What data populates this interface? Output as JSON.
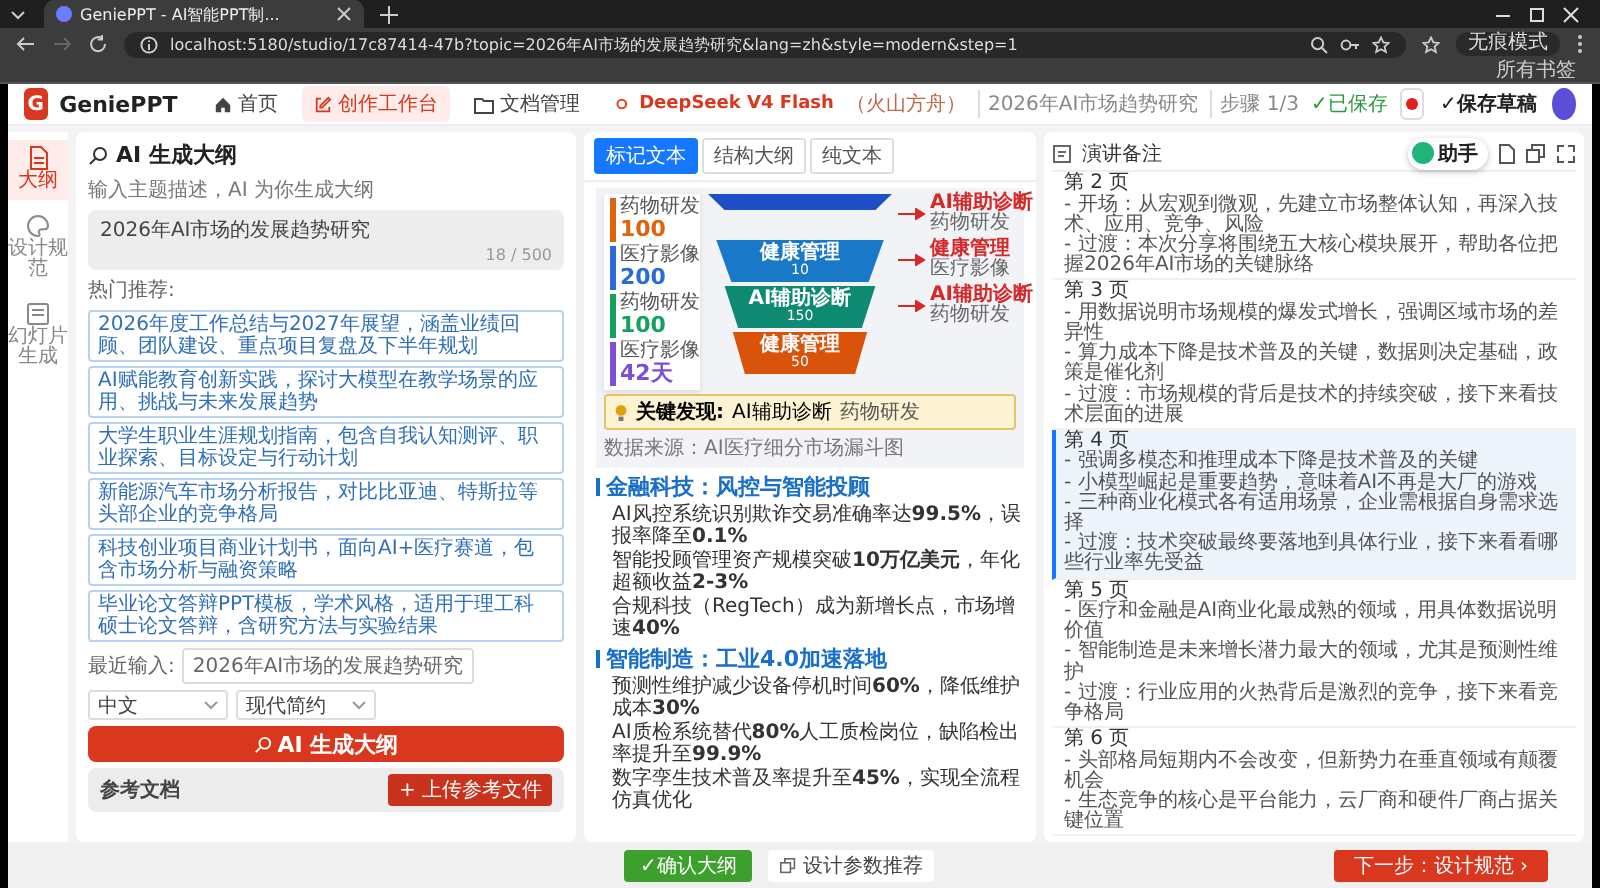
{
  "browser": {
    "tab_title": "GeniePPT - AI智能PPT制...",
    "url": "localhost:5180/studio/17c87414-47b?topic=2026年AI市场的发展趋势研究&lang=zh&style=modern&step=1",
    "profile": "无痕模式",
    "bookmarks": "所有书签"
  },
  "header": {
    "logo": "G",
    "brand": "GeniePPT",
    "nav": [
      {
        "label": "首页",
        "selected": false
      },
      {
        "label": "创作工作台",
        "selected": true
      },
      {
        "label": "文档管理",
        "selected": false
      }
    ],
    "model": "DeepSeek V4 Flash",
    "provider": "（火山方舟）",
    "project": "2026年AI市场趋势研究",
    "step": "步骤 1/3",
    "save_status": "✓已保存",
    "save_button": "✓保存草稿"
  },
  "sidebar": [
    {
      "label": "大纲",
      "selected": true
    },
    {
      "label": "设计规范",
      "selected": false
    },
    {
      "label": "幻灯片生成",
      "selected": false
    }
  ],
  "outline_panel": {
    "title": "AI 生成大纲",
    "subtitle": "输入主题描述，AI 为你生成大纲",
    "topic": "2026年AI市场的发展趋势研究",
    "counter": "18 / 500",
    "hot_label": "热门推荐:",
    "hot_topics": [
      "2026年度工作总结与2027年展望，涵盖业绩回顾、团队建设、重点项目复盘及下半年规划",
      "AI赋能教育创新实践，探讨大模型在教学场景的应用、挑战与未来发展趋势",
      "大学生职业生涯规划指南，包含自我认知测评、职业探索、目标设定与行动计划",
      "新能源汽车市场分析报告，对比比亚迪、特斯拉等头部企业的竞争格局",
      "科技创业项目商业计划书，面向AI+医疗赛道，包含市场分析与融资策略",
      "毕业论文答辩PPT模板，学术风格，适用于理工科硕士论文答辩，含研究方法与实验结果"
    ],
    "recent_label": "最近输入:",
    "recent": [
      "2026年AI市场的发展趋势研究"
    ],
    "language": "中文",
    "style": "现代简约",
    "generate_button": "AI 生成大纲",
    "reference_label": "参考文档",
    "upload_button": "+ 上传参考文件"
  },
  "editor": {
    "tabs": [
      {
        "label": "标记文本",
        "selected": true
      },
      {
        "label": "结构大纲",
        "selected": false
      },
      {
        "label": "纯文本",
        "selected": false
      }
    ],
    "preview": {
      "metrics": [
        {
          "label": "药物研发",
          "value": "100",
          "color": "#e0620d"
        },
        {
          "label": "医疗影像",
          "value": "200",
          "color": "#2b6cd4"
        },
        {
          "label": "药物研发",
          "value": "100",
          "color": "#15a060"
        },
        {
          "label": "医疗影像",
          "value": "42天",
          "color": "#7b4fd6"
        }
      ],
      "stages": [
        {
          "color": "#1f4fc8"
        },
        {
          "label": "健康管理",
          "value": "10",
          "color": "#1a78c8"
        },
        {
          "label": "AI辅助诊断",
          "value": "150",
          "color": "#0f8a72"
        },
        {
          "label": "健康管理",
          "value": "50",
          "color": "#d9530a"
        }
      ],
      "callouts": [
        {
          "title": "AI辅助诊断",
          "note": "药物研发"
        },
        {
          "title": "健康管理",
          "note": "医疗影像"
        },
        {
          "title": "AI辅助诊断",
          "note": "药物研发"
        }
      ],
      "insight": {
        "label": "关键发现:",
        "text": "AI辅助诊断",
        "note": "药物研发"
      },
      "source": "数据来源：AI医疗细分市场漏斗图"
    },
    "sections": [
      {
        "heading": "金融科技：风控与智能投顾",
        "items": [
          "AI风控系统识别欺诈交易准确率达**99.5%**，误报率降至**0.1%**",
          "智能投顾管理资产规模突破**10万亿美元**，年化超额收益**2-3%**",
          "合规科技（RegTech）成为新增长点，市场增速**40%**"
        ]
      },
      {
        "heading": "智能制造：工业4.0加速落地",
        "items": [
          "预测性维护减少设备停机时间**60%**，降低维护成本**30%**",
          "AI质检系统替代**80%**人工质检岗位，缺陷检出率提升至**99.9%**",
          "数字孪生技术普及率提升至**45%**，实现全流程仿真优化"
        ]
      }
    ]
  },
  "notes": {
    "title": "演讲备注",
    "assistant": "助手",
    "pages": [
      {
        "title": "第 2 页",
        "selected": false,
        "lines": [
          "- 开场：从宏观到微观，先建立市场整体认知，再深入技术、应用、竞争、风险",
          "- 过渡：本次分享将围绕五大核心模块展开，帮助各位把握2026年AI市场的关键脉络"
        ]
      },
      {
        "title": "第 3 页",
        "selected": false,
        "lines": [
          "- 用数据说明市场规模的爆发式增长，强调区域市场的差异性",
          "- 算力成本下降是技术普及的关键，数据则决定基础，政策是催化剂",
          "- 过渡：市场规模的背后是技术的持续突破，接下来看技术层面的进展"
        ]
      },
      {
        "title": "第 4 页",
        "selected": true,
        "lines": [
          "- 强调多模态和推理成本下降是技术普及的关键",
          "- 小模型崛起是重要趋势，意味着AI不再是大厂的游戏",
          "- 三种商业化模式各有适用场景，企业需根据自身需求选择",
          "- 过渡：技术突破最终要落地到具体行业，接下来看看哪些行业率先受益"
        ]
      },
      {
        "title": "第 5 页",
        "selected": false,
        "lines": [
          "- 医疗和金融是AI商业化最成熟的领域，用具体数据说明价值",
          "- 智能制造是未来增长潜力最大的领域，尤其是预测性维护",
          "- 过渡：行业应用的火热背后是激烈的竞争，接下来看竞争格局"
        ]
      },
      {
        "title": "第 6 页",
        "selected": false,
        "lines": [
          "- 头部格局短期内不会改变，但新势力在垂直领域有颠覆机会",
          "- 生态竞争的核心是平台能力，云厂商和硬件厂商占据关键位置"
        ]
      }
    ]
  },
  "footer": {
    "confirm_button": "✓确认大纲",
    "params_button": "设计参数推荐",
    "next_button": "下一步：设计规范 ›"
  }
}
